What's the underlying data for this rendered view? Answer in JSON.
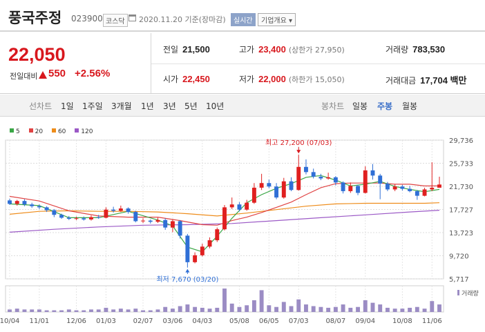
{
  "header": {
    "stock_name": "풍국주정",
    "stock_code": "023900",
    "market_badge": "코스닥",
    "calendar_icon": "calendar-icon",
    "date_text": "2020.11.20  기준(장마감)",
    "realtime_button": "실시간",
    "company_info_button": "기업개요 ▾"
  },
  "quote": {
    "price": "22,050",
    "compare_label": "전일대비",
    "change": "550",
    "change_pct": "+2.56%",
    "prev_close_label": "전일",
    "prev_close": "21,500",
    "high_label": "고가",
    "high": "23,400",
    "upper_limit": "(상한가 27,950)",
    "volume_label": "거래량",
    "volume": "783,530",
    "open_label": "시가",
    "open": "22,450",
    "low_label": "저가",
    "low": "22,000",
    "lower_limit": "(하한가 15,050)",
    "amount_label": "거래대금",
    "amount": "17,704 백만",
    "up_color": "#d8171d"
  },
  "tabs": {
    "line_group_label": "선차트",
    "line_tabs": [
      "1일",
      "1주일",
      "3개월",
      "1년",
      "3년",
      "5년",
      "10년"
    ],
    "candle_group_label": "봉차트",
    "candle_tabs": [
      "일봉",
      "주봉",
      "월봉"
    ],
    "selected_candle_tab": "주봉"
  },
  "chart_data": {
    "type": "candlestick",
    "legend": [
      {
        "name": "5",
        "color": "#3aa646"
      },
      {
        "name": "20",
        "color": "#e04343"
      },
      {
        "name": "60",
        "color": "#ee8c1a"
      },
      {
        "name": "120",
        "color": "#9b59c6"
      }
    ],
    "up_color": "#e02020",
    "down_color": "#2f6fd6",
    "y_ticks": [
      "29,736",
      "25,733",
      "21,730",
      "17,727",
      "13,723",
      "9,720",
      "5,717"
    ],
    "y_tick_values": [
      29736,
      25733,
      21730,
      17727,
      13723,
      9720,
      5717
    ],
    "ylim": [
      5717,
      29736
    ],
    "x_ticks": [
      {
        "label": "10/04",
        "i": 0
      },
      {
        "label": "11/01",
        "i": 4
      },
      {
        "label": "12/06",
        "i": 9
      },
      {
        "label": "01/03",
        "i": 13
      },
      {
        "label": "02/07",
        "i": 18
      },
      {
        "label": "03/06",
        "i": 22
      },
      {
        "label": "04/03",
        "i": 26
      },
      {
        "label": "05/08",
        "i": 31
      },
      {
        "label": "06/05",
        "i": 35
      },
      {
        "label": "07/03",
        "i": 39
      },
      {
        "label": "08/07",
        "i": 44
      },
      {
        "label": "09/04",
        "i": 48
      },
      {
        "label": "10/08",
        "i": 53
      },
      {
        "label": "11/06",
        "i": 57
      }
    ],
    "high_annotation": "최고 27,200 (07/03)",
    "high_index": 39,
    "high_value": 27200,
    "low_annotation": "최저 7,670 (03/20)",
    "low_index": 24,
    "low_value": 7670,
    "volume_label": "거래량",
    "candles": [
      [
        19300,
        18700,
        19600,
        18500
      ],
      [
        18700,
        19200,
        19400,
        18400
      ],
      [
        19200,
        18600,
        19500,
        18300
      ],
      [
        18600,
        18300,
        18900,
        18000
      ],
      [
        18300,
        18100,
        18600,
        17800
      ],
      [
        18100,
        17600,
        18300,
        17300
      ],
      [
        17600,
        16800,
        17800,
        16400
      ],
      [
        16800,
        16300,
        17000,
        16100
      ],
      [
        16300,
        16100,
        16600,
        15900
      ],
      [
        16100,
        16200,
        16500,
        15900
      ],
      [
        16200,
        16000,
        16500,
        15800
      ],
      [
        16000,
        16400,
        16700,
        15800
      ],
      [
        16400,
        16300,
        16800,
        16100
      ],
      [
        16300,
        17700,
        18100,
        16200
      ],
      [
        17700,
        17500,
        18200,
        17200
      ],
      [
        17500,
        17900,
        18400,
        17300
      ],
      [
        17900,
        17300,
        18100,
        17000
      ],
      [
        17300,
        15700,
        17500,
        15500
      ],
      [
        15700,
        15800,
        16200,
        15400
      ],
      [
        15800,
        15600,
        16000,
        15300
      ],
      [
        15600,
        15900,
        16300,
        15400
      ],
      [
        15900,
        14600,
        16200,
        14200
      ],
      [
        14600,
        15700,
        16000,
        13800
      ],
      [
        15700,
        13200,
        15900,
        12700
      ],
      [
        13200,
        8600,
        13500,
        7670
      ],
      [
        8600,
        9800,
        10300,
        8400
      ],
      [
        9800,
        11300,
        11800,
        9600
      ],
      [
        11300,
        12400,
        12900,
        11000
      ],
      [
        12400,
        14300,
        14600,
        12100
      ],
      [
        14300,
        18100,
        18500,
        14100
      ],
      [
        18100,
        18600,
        19800,
        17800
      ],
      [
        18600,
        17700,
        19000,
        17400
      ],
      [
        17700,
        18900,
        19400,
        17500
      ],
      [
        18900,
        21500,
        22300,
        18700
      ],
      [
        21500,
        22300,
        23900,
        21100
      ],
      [
        22300,
        21700,
        22900,
        21400
      ],
      [
        21700,
        19800,
        22300,
        19500
      ],
      [
        19800,
        22600,
        23200,
        19600
      ],
      [
        22600,
        21100,
        23300,
        20900
      ],
      [
        21100,
        25100,
        27200,
        21000
      ],
      [
        25100,
        24200,
        26400,
        23800
      ],
      [
        24200,
        23400,
        24800,
        23100
      ],
      [
        23400,
        23100,
        23900,
        22800
      ],
      [
        23100,
        23300,
        24100,
        22900
      ],
      [
        23300,
        22400,
        23500,
        21900
      ],
      [
        22400,
        20900,
        22600,
        20500
      ],
      [
        20900,
        21800,
        22400,
        20600
      ],
      [
        21800,
        20600,
        22000,
        20200
      ],
      [
        20600,
        24500,
        25200,
        20500
      ],
      [
        24500,
        23600,
        25600,
        22900
      ],
      [
        23600,
        22200,
        23900,
        19500
      ],
      [
        22200,
        21200,
        22500,
        20900
      ],
      [
        21200,
        21700,
        22100,
        20900
      ],
      [
        21700,
        21300,
        22000,
        21000
      ],
      [
        21300,
        20900,
        21800,
        20700
      ],
      [
        20900,
        20100,
        21100,
        19400
      ],
      [
        20100,
        21200,
        21500,
        20000
      ],
      [
        21200,
        21500,
        25900,
        20900
      ],
      [
        21500,
        22050,
        23400,
        22000
      ]
    ],
    "volumes": [
      3,
      4,
      3,
      3,
      3,
      2,
      2,
      2,
      3,
      2,
      2,
      3,
      3,
      5,
      3,
      4,
      3,
      4,
      2,
      2,
      3,
      6,
      4,
      7,
      9,
      6,
      5,
      4,
      5,
      28,
      10,
      6,
      8,
      14,
      26,
      8,
      6,
      12,
      7,
      15,
      9,
      7,
      6,
      5,
      6,
      9,
      5,
      6,
      14,
      11,
      9,
      5,
      4,
      4,
      5,
      6,
      4,
      13,
      9
    ],
    "ma": {
      "5": [
        [
          0,
          18700
        ],
        [
          4,
          18400
        ],
        [
          8,
          16300
        ],
        [
          12,
          16300
        ],
        [
          16,
          17400
        ],
        [
          20,
          15900
        ],
        [
          22,
          14900
        ],
        [
          24,
          11200
        ],
        [
          26,
          10400
        ],
        [
          28,
          13100
        ],
        [
          30,
          16200
        ],
        [
          32,
          18900
        ],
        [
          34,
          20300
        ],
        [
          36,
          21400
        ],
        [
          38,
          22200
        ],
        [
          40,
          23300
        ],
        [
          42,
          23600
        ],
        [
          44,
          22800
        ],
        [
          46,
          21800
        ],
        [
          48,
          22100
        ],
        [
          50,
          22600
        ],
        [
          52,
          21700
        ],
        [
          54,
          21200
        ],
        [
          56,
          20800
        ],
        [
          58,
          21200
        ]
      ],
      "20": [
        [
          0,
          20000
        ],
        [
          4,
          19200
        ],
        [
          8,
          17500
        ],
        [
          12,
          16600
        ],
        [
          16,
          16400
        ],
        [
          20,
          16400
        ],
        [
          23,
          15800
        ],
        [
          26,
          15100
        ],
        [
          28,
          15000
        ],
        [
          30,
          15800
        ],
        [
          32,
          16400
        ],
        [
          34,
          17200
        ],
        [
          36,
          18100
        ],
        [
          38,
          19000
        ],
        [
          40,
          20300
        ],
        [
          42,
          21500
        ],
        [
          44,
          22200
        ],
        [
          46,
          22300
        ],
        [
          48,
          22300
        ],
        [
          50,
          22300
        ],
        [
          52,
          22100
        ],
        [
          54,
          22100
        ],
        [
          56,
          21800
        ],
        [
          58,
          21800
        ]
      ],
      "60": [
        [
          0,
          16900
        ],
        [
          4,
          17400
        ],
        [
          8,
          17500
        ],
        [
          12,
          17400
        ],
        [
          16,
          17400
        ],
        [
          20,
          17300
        ],
        [
          24,
          17000
        ],
        [
          28,
          16600
        ],
        [
          32,
          17100
        ],
        [
          36,
          17700
        ],
        [
          40,
          18300
        ],
        [
          44,
          18700
        ],
        [
          48,
          18800
        ],
        [
          52,
          18800
        ],
        [
          56,
          18800
        ],
        [
          58,
          18900
        ]
      ],
      "120": [
        [
          0,
          13800
        ],
        [
          6,
          14300
        ],
        [
          12,
          14700
        ],
        [
          18,
          15000
        ],
        [
          24,
          15100
        ],
        [
          30,
          15300
        ],
        [
          36,
          15800
        ],
        [
          42,
          16300
        ],
        [
          48,
          16800
        ],
        [
          54,
          17300
        ],
        [
          58,
          17600
        ]
      ]
    }
  }
}
